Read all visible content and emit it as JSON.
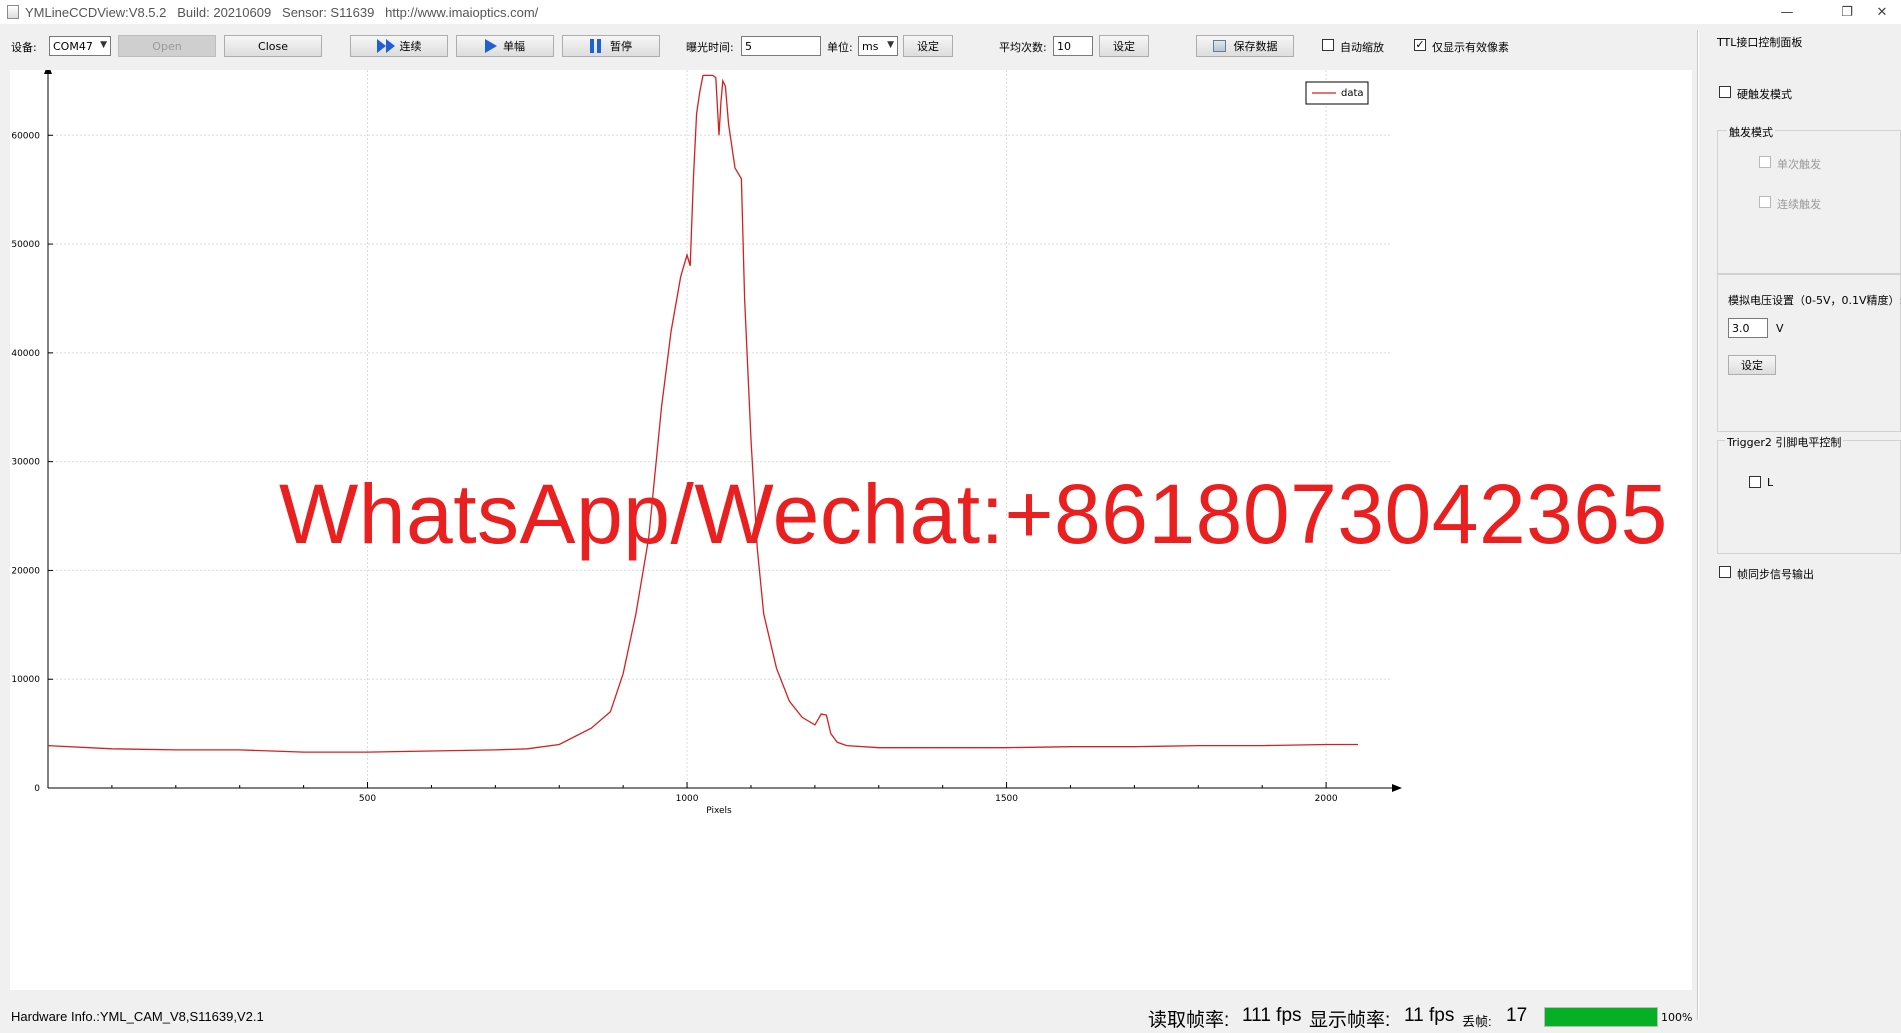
{
  "window": {
    "title": "YMLineCCDView:V8.5.2   Build: 20210609   Sensor: S11639   http://www.imaioptics.com/",
    "minimize_glyph": "—",
    "restore_glyph": "❐",
    "close_glyph": "✕"
  },
  "toolbar": {
    "device_label": "设备:",
    "device_value": "COM47",
    "open_label": "Open",
    "close_label": "Close",
    "continuous_label": "连续",
    "single_label": "单幅",
    "pause_label": "暂停",
    "exposure_label": "曝光时间:",
    "exposure_value": "5",
    "unit_label": "单位:",
    "unit_value": "ms",
    "set_label": "设定",
    "average_label": "平均次数:",
    "average_value": "10",
    "average_set_label": "设定",
    "save_label": "保存数据",
    "auto_scale_label": "自动缩放",
    "auto_scale_checked": false,
    "valid_pixels_label": "仅显示有效像素",
    "valid_pixels_checked": true,
    "check_mark": "✓"
  },
  "chart_data": {
    "type": "line",
    "title": "",
    "xlabel": "Pixels",
    "ylabel": "",
    "xlim": [
      0,
      2100
    ],
    "ylim": [
      0,
      66000
    ],
    "x_ticks": [
      500,
      1000,
      1500,
      2000
    ],
    "y_ticks": [
      0,
      10000,
      20000,
      30000,
      40000,
      50000,
      60000
    ],
    "grid": true,
    "legend_position": "top-right",
    "series": [
      {
        "name": "data",
        "color": "#d42020",
        "x": [
          0,
          100,
          200,
          300,
          400,
          500,
          600,
          700,
          750,
          800,
          850,
          880,
          900,
          920,
          940,
          960,
          975,
          990,
          1000,
          1005,
          1010,
          1015,
          1020,
          1025,
          1030,
          1040,
          1045,
          1050,
          1053,
          1056,
          1060,
          1065,
          1075,
          1085,
          1090,
          1100,
          1110,
          1120,
          1140,
          1160,
          1180,
          1200,
          1210,
          1218,
          1225,
          1235,
          1250,
          1300,
          1400,
          1500,
          1600,
          1700,
          1800,
          1900,
          2000,
          2050
        ],
        "y": [
          3900,
          3600,
          3500,
          3500,
          3300,
          3300,
          3400,
          3500,
          3600,
          4000,
          5500,
          7000,
          10500,
          16000,
          23000,
          35000,
          42000,
          47000,
          49000,
          48000,
          56000,
          62000,
          64000,
          65500,
          65500,
          65500,
          65300,
          60000,
          63000,
          65000,
          64500,
          61000,
          57000,
          56000,
          45000,
          32000,
          22000,
          16000,
          11000,
          8000,
          6500,
          5800,
          6800,
          6700,
          5000,
          4200,
          3900,
          3700,
          3700,
          3700,
          3800,
          3800,
          3900,
          3900,
          4000,
          4000
        ]
      }
    ]
  },
  "panel": {
    "title": "TTL接口控制面板",
    "hard_trigger_label": "硬触发模式",
    "trigger_mode_title": "触发模式",
    "single_trigger_label": "单次触发",
    "continuous_trigger_label": "连续触发",
    "voltage_title": "模拟电压设置（0-5V，0.1V精度）:",
    "voltage_value": "3.0",
    "voltage_unit": "V",
    "voltage_set_label": "设定",
    "trigger2_title": "Trigger2 引脚电平控制",
    "trigger2_level_label": "L",
    "frame_sync_label": "帧同步信号输出"
  },
  "status": {
    "hardware_info": "Hardware Info.:YML_CAM_V8,S11639,V2.1",
    "read_fps_label": "读取帧率:",
    "read_fps_value": "111 fps",
    "display_fps_label": "显示帧率:",
    "display_fps_value": "11 fps",
    "dropped_label": "丢帧:",
    "dropped_value": "17",
    "progress_percent": 100,
    "progress_text": "100%"
  },
  "watermark": {
    "text": "WhatsApp/Wechat:+8618073042365"
  }
}
